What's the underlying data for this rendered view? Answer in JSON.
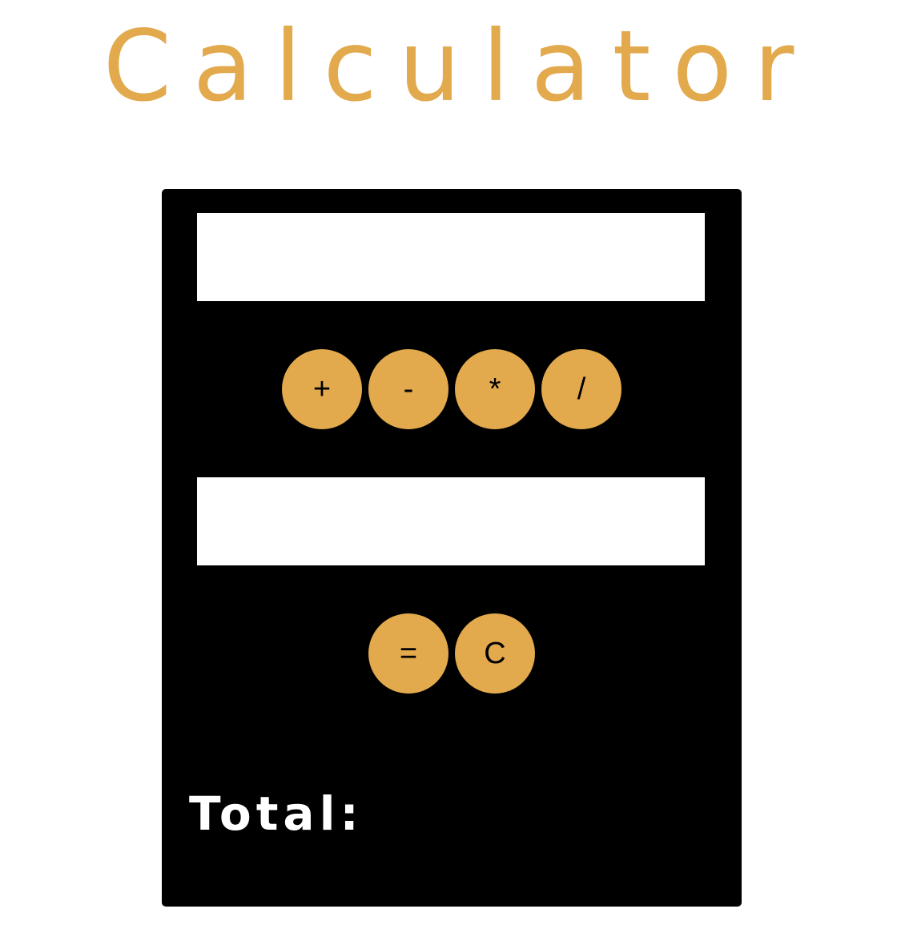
{
  "app": {
    "title": "Calculator"
  },
  "inputs": {
    "first": {
      "value": "",
      "placeholder": ""
    },
    "second": {
      "value": "",
      "placeholder": ""
    }
  },
  "operators": [
    {
      "label": "+"
    },
    {
      "label": "-"
    },
    {
      "label": "*"
    },
    {
      "label": "/"
    }
  ],
  "actions": {
    "equals_label": "=",
    "clear_label": "C"
  },
  "result": {
    "label": "Total:",
    "value": ""
  },
  "colors": {
    "accent": "#e2a94d",
    "panel": "#000000",
    "field": "#ffffff",
    "label_text": "#ffffff"
  }
}
